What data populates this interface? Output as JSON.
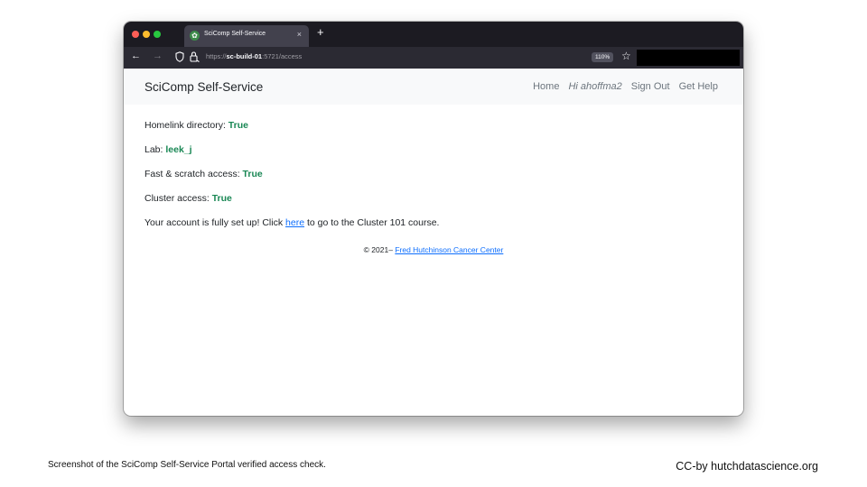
{
  "browser": {
    "tab_title": "SciComp Self-Service",
    "tab_close": "×",
    "new_tab": "+",
    "url_scheme": "https://",
    "url_host": "sc-build-01",
    "url_rest": ":5721/access",
    "zoom": "110%",
    "back_icon": "←",
    "forward_icon": "→",
    "bookmark_icon": "☆",
    "favicon": "✿"
  },
  "app": {
    "brand": "SciComp Self-Service",
    "nav": {
      "home": "Home",
      "user": "Hi ahoffma2",
      "sign_out": "Sign Out",
      "help": "Get Help"
    }
  },
  "status": {
    "homelink_label": "Homelink directory:",
    "homelink_value": "True",
    "lab_label": "Lab:",
    "lab_value": "leek_j",
    "scratch_label": "Fast & scratch access:",
    "scratch_value": "True",
    "cluster_label": "Cluster access:",
    "cluster_value": "True",
    "message_before": "Your account is fully set up! Click",
    "message_link": "here",
    "message_after": "to go to the Cluster 101 course."
  },
  "footer": {
    "copyright": "© 2021–",
    "org_link": "Fred Hutchinson Cancer Center"
  },
  "slide": {
    "caption": "Screenshot of the SciComp Self-Service Portal verified access check.",
    "credit": "CC-by hutchdatascience.org"
  },
  "colors": {
    "success": "#198754",
    "link": "#0d6efd",
    "titlebar": "#1c1b22",
    "toolbar": "#2b2a33"
  }
}
